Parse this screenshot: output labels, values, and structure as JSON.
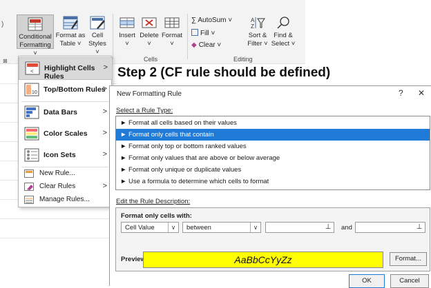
{
  "ribbon": {
    "conditional_formatting": {
      "line1": "Conditional",
      "line2": "Formatting ˅"
    },
    "format_as_table": {
      "line1": "Format as",
      "line2": "Table ˅"
    },
    "cell_styles": {
      "line1": "Cell",
      "line2": "Styles ˅"
    },
    "insert": {
      "line1": "Insert",
      "line2": "˅"
    },
    "delete": {
      "line1": "Delete",
      "line2": "˅"
    },
    "format": {
      "line1": "Format",
      "line2": "˅"
    },
    "autosum": "∑ AutoSum  ˅",
    "fill": "Fill ˅",
    "clear": "Clear ˅",
    "sort_filter": {
      "line1": "Sort &",
      "line2": "Filter ˅"
    },
    "find_select": {
      "line1": "Find &",
      "line2": "Select ˅"
    },
    "group_cells": "Cells",
    "group_editing": "Editing"
  },
  "cf_menu": {
    "items": [
      {
        "label": "Highlight Cells Rules",
        "submenu": true
      },
      {
        "label": "Top/Bottom Rules",
        "submenu": true
      },
      {
        "label": "Data Bars",
        "submenu": true
      },
      {
        "label": "Color Scales",
        "submenu": true
      },
      {
        "label": "Icon Sets",
        "submenu": true
      },
      {
        "label": "New Rule...",
        "submenu": false
      },
      {
        "label": "Clear Rules",
        "submenu": true
      },
      {
        "label": "Manage Rules...",
        "submenu": false
      }
    ]
  },
  "step_heading": "Step 2 (CF rule should be defined)",
  "dialog": {
    "title": "New Formatting Rule",
    "help": "?",
    "close": "✕",
    "select_type_label": "Select a Rule Type:",
    "rule_types": [
      "► Format all cells based on their values",
      "► Format only cells that contain",
      "► Format only top or bottom ranked values",
      "► Format only values that are above or below average",
      "► Format only unique or duplicate values",
      "► Use a formula to determine which cells to format"
    ],
    "selected_rule_index": 1,
    "edit_desc_label": "Edit the Rule Description:",
    "format_only_label": "Format only cells with:",
    "condition_value": "Cell Value",
    "operator_value": "between",
    "and_label": "and",
    "preview_label": "Preview:",
    "preview_text": "AaBbCcYyZz",
    "format_button": "Format...",
    "ok_button": "OK",
    "cancel_button": "Cancel"
  }
}
